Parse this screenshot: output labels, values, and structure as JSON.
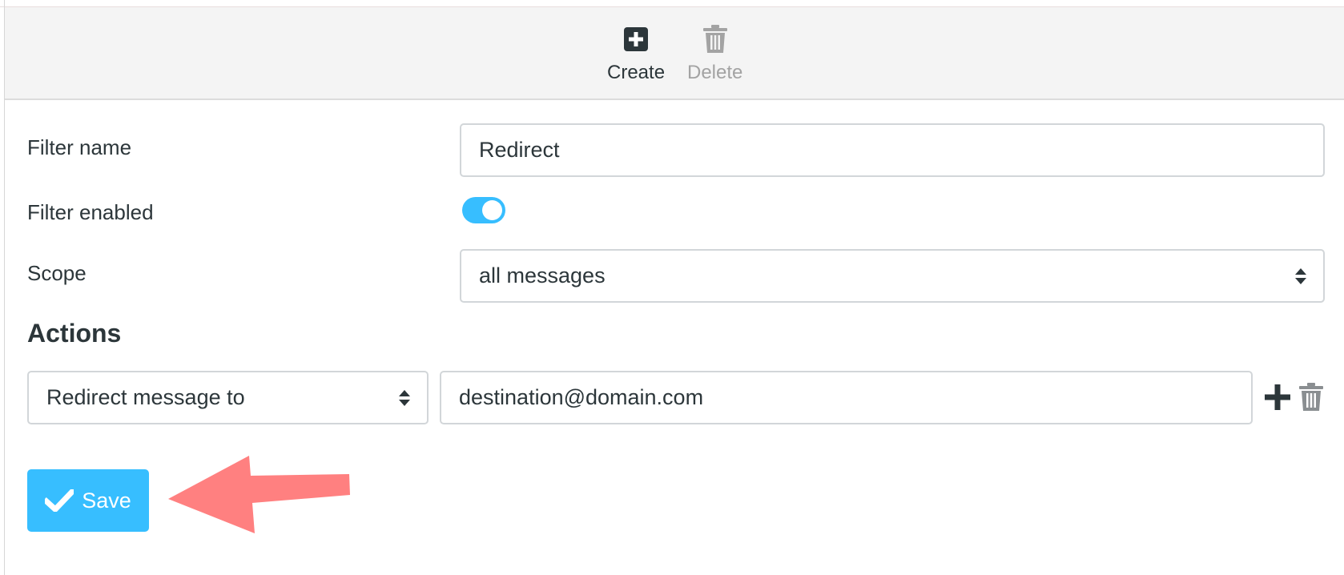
{
  "toolbar": {
    "create_label": "Create",
    "delete_label": "Delete"
  },
  "form": {
    "filter_name_label": "Filter name",
    "filter_name_value": "Redirect",
    "filter_enabled_label": "Filter enabled",
    "filter_enabled": true,
    "scope_label": "Scope",
    "scope_value": "all messages"
  },
  "actions": {
    "title": "Actions",
    "rows": [
      {
        "action_type": "Redirect message to",
        "target": "destination@domain.com"
      }
    ]
  },
  "save": {
    "label": "Save"
  },
  "colors": {
    "accent": "#37beff",
    "text": "#2c363a",
    "disabled": "#a3a3a3",
    "annotation_arrow": "#ff8080"
  }
}
